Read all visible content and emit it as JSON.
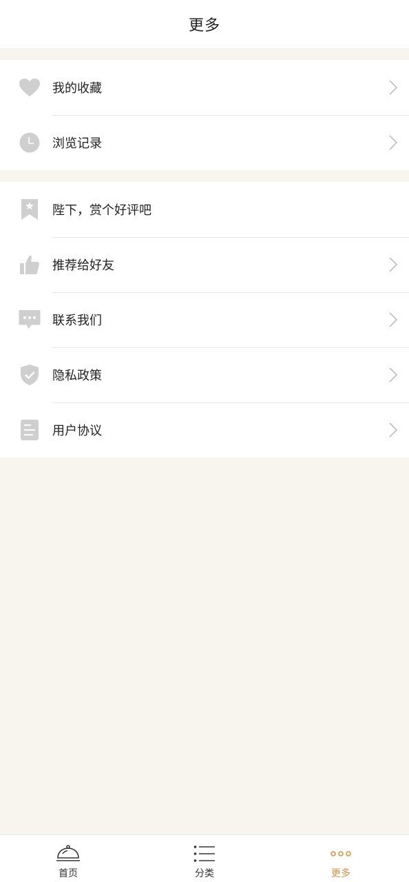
{
  "header": {
    "title": "更多"
  },
  "groups": [
    {
      "items": [
        {
          "label": "我的收藏",
          "icon": "heart-icon"
        },
        {
          "label": "浏览记录",
          "icon": "clock-icon"
        }
      ]
    },
    {
      "items": [
        {
          "label": "陛下，赏个好评吧",
          "icon": "bookmark-star-icon"
        },
        {
          "label": "推荐给好友",
          "icon": "thumbs-up-icon"
        },
        {
          "label": "联系我们",
          "icon": "chat-bubble-icon"
        },
        {
          "label": "隐私政策",
          "icon": "shield-check-icon"
        },
        {
          "label": "用户协议",
          "icon": "document-icon"
        }
      ]
    }
  ],
  "tabbar": {
    "tabs": [
      {
        "label": "首页",
        "icon": "cloche-icon"
      },
      {
        "label": "分类",
        "icon": "list-icon"
      },
      {
        "label": "更多",
        "icon": "more-dots-icon",
        "active": true
      }
    ]
  },
  "colors": {
    "background": "#f7f5ee",
    "icon_gray": "#cfcfcf",
    "accent": "#e28f3e"
  }
}
